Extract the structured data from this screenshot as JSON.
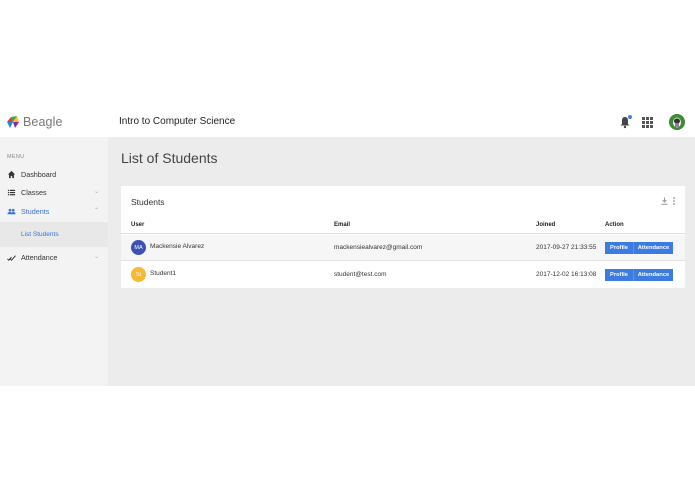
{
  "app": {
    "brand_name": "Beagle",
    "course_title": "Intro to Computer Science"
  },
  "sidebar": {
    "menu_label": "MENU",
    "items": [
      {
        "label": "Dashboard",
        "icon": "home-icon"
      },
      {
        "label": "Classes",
        "icon": "list-icon"
      },
      {
        "label": "Students",
        "icon": "people-icon",
        "active": true
      },
      {
        "label": "Attendance",
        "icon": "check-icon"
      }
    ],
    "sub_item": "List Students"
  },
  "main": {
    "page_title": "List of Students",
    "card_title": "Students",
    "columns": [
      "User",
      "Email",
      "Joined",
      "Action"
    ],
    "rows": [
      {
        "initials": "MA",
        "avatar_color": "#3f51b5",
        "name": "Mackensie Alvarez",
        "email": "mackensiealvarez@gmail.com",
        "joined": "2017-09-27 21:33:55",
        "profile_label": "Profile",
        "attendance_label": "Attendance"
      },
      {
        "initials": "St",
        "avatar_color": "#f5b935",
        "name": "Student1",
        "email": "student@test.com",
        "joined": "2017-12-02 16:13:08",
        "profile_label": "Profile",
        "attendance_label": "Attendance"
      }
    ]
  },
  "colors": {
    "accent": "#3b72d9",
    "button": "#3c7bdf",
    "sidebar_bg": "#f3f3f3",
    "main_bg": "#ececec"
  }
}
